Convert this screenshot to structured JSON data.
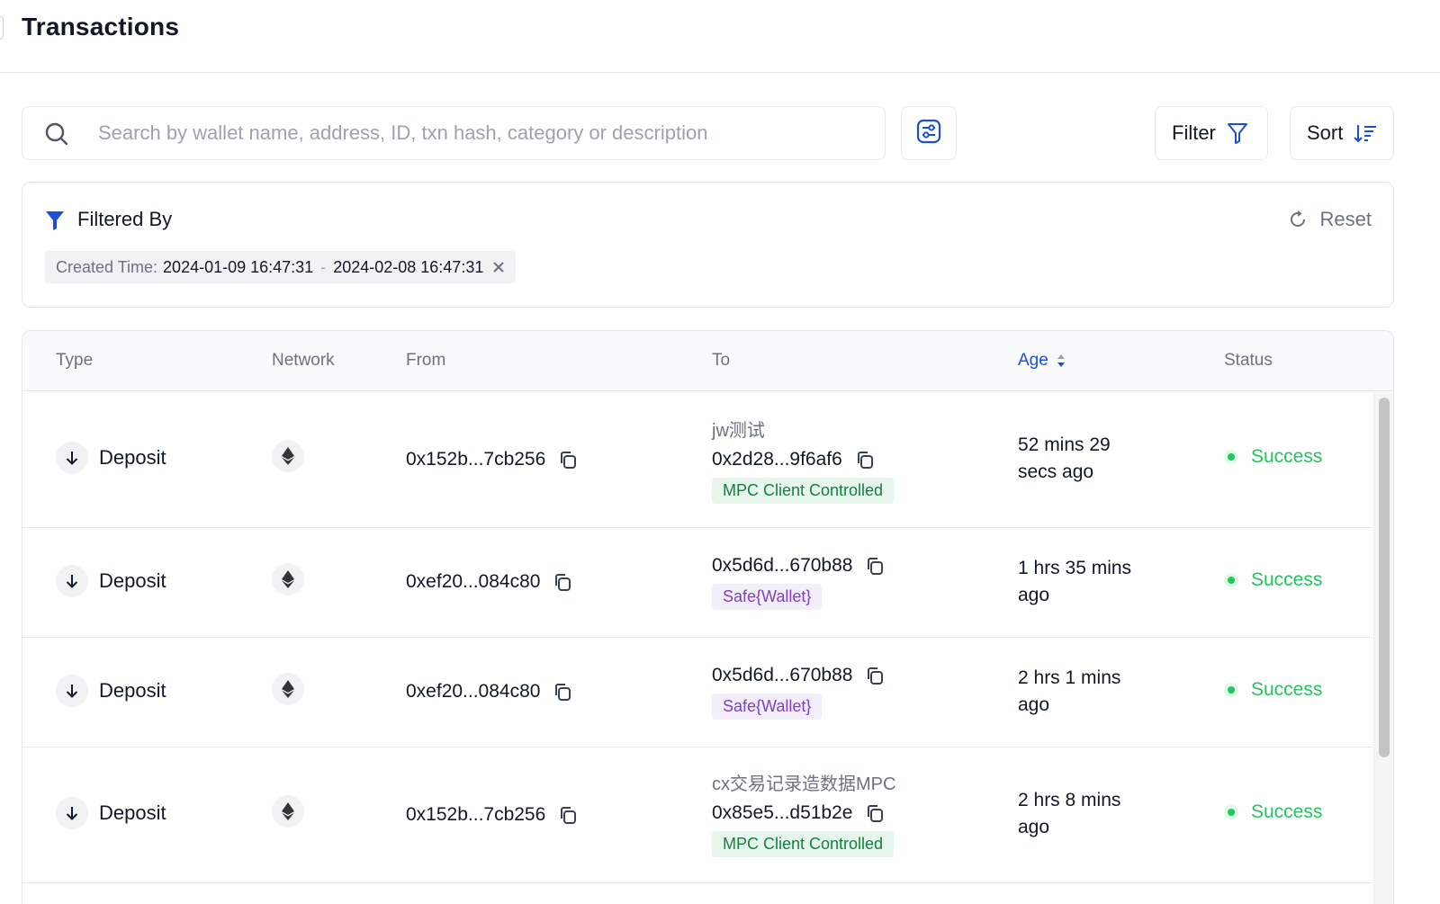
{
  "header": {
    "title": "Transactions"
  },
  "search": {
    "placeholder": "Search by wallet name, address, ID, txn hash, category or description"
  },
  "toolbar": {
    "filter_label": "Filter",
    "sort_label": "Sort"
  },
  "filter_panel": {
    "title": "Filtered By",
    "reset_label": "Reset",
    "chip": {
      "label": "Created Time:",
      "start": "2024-01-09 16:47:31",
      "separator": "-",
      "end": "2024-02-08 16:47:31"
    }
  },
  "table": {
    "columns": {
      "type": "Type",
      "network": "Network",
      "from": "From",
      "to": "To",
      "age": "Age",
      "status": "Status"
    },
    "rows": [
      {
        "type": "Deposit",
        "network_icon": "ethereum-icon",
        "from": "0x152b...7cb256",
        "to_name": "jw测试",
        "to": "0x2d28...9f6af6",
        "tag": "MPC Client Controlled",
        "tag_color": "#15803d",
        "age_line1": "52 mins 29",
        "age_line2": "secs ago",
        "status": "Success"
      },
      {
        "type": "Deposit",
        "network_icon": "ethereum-icon",
        "from": "0xef20...084c80",
        "to_name": "",
        "to": "0x5d6d...670b88",
        "tag": "Safe{Wallet}",
        "tag_color": "#7e3fc0",
        "age_line1": "1 hrs 35 mins",
        "age_line2": "ago",
        "status": "Success"
      },
      {
        "type": "Deposit",
        "network_icon": "ethereum-icon",
        "from": "0xef20...084c80",
        "to_name": "",
        "to": "0x5d6d...670b88",
        "tag": "Safe{Wallet}",
        "tag_color": "#7e3fc0",
        "age_line1": "2 hrs 1 mins",
        "age_line2": "ago",
        "status": "Success"
      },
      {
        "type": "Deposit",
        "network_icon": "ethereum-icon",
        "from": "0x152b...7cb256",
        "to_name": "cx交易记录造数据MPC",
        "to": "0x85e5...d51b2e",
        "tag": "MPC Client Controlled",
        "tag_color": "#15803d",
        "age_line1": "2 hrs 8 mins",
        "age_line2": "ago",
        "status": "Success"
      }
    ]
  },
  "colors": {
    "accent": "#1d4ed8",
    "success": "#22c55e",
    "muted": "#6b7280"
  }
}
